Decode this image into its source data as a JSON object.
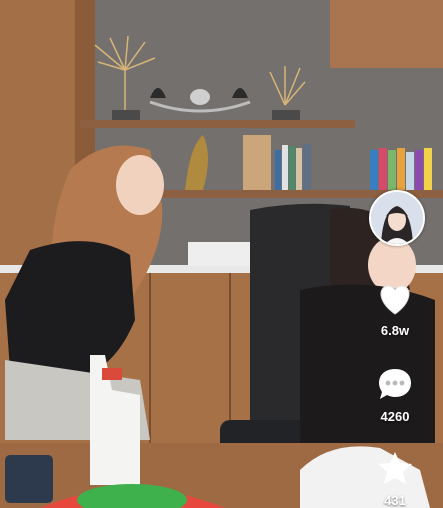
{
  "actions": {
    "like": {
      "icon": "heart-icon",
      "count": "6.8w"
    },
    "comment": {
      "icon": "comment-bubble-icon",
      "count": "4260"
    },
    "favorite": {
      "icon": "star-icon",
      "count": "431"
    }
  },
  "author": {
    "avatar_icon": "creator-avatar"
  },
  "colors": {
    "wall": "#6f6a66",
    "wood": "#9a6a45",
    "overlay_text": "#ffffff"
  }
}
